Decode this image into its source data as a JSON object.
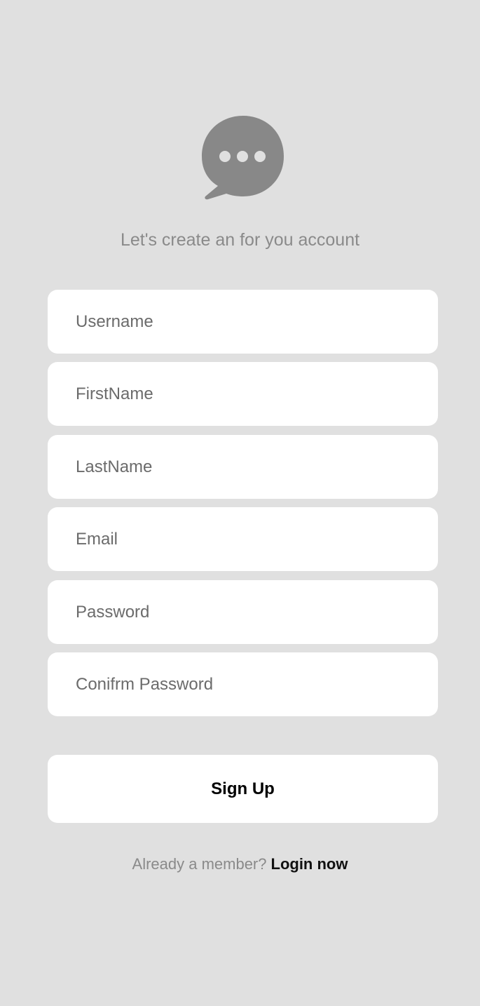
{
  "app": {
    "logo_icon": "chat-bubble-icon",
    "subtitle": "Let's create an for you account"
  },
  "form": {
    "fields": [
      {
        "name": "username",
        "placeholder": "Username",
        "value": ""
      },
      {
        "name": "firstname",
        "placeholder": "FirstName",
        "value": ""
      },
      {
        "name": "lastname",
        "placeholder": "LastName",
        "value": ""
      },
      {
        "name": "email",
        "placeholder": "Email",
        "value": ""
      },
      {
        "name": "password",
        "placeholder": "Password",
        "value": ""
      },
      {
        "name": "confirm_password",
        "placeholder": "Conifrm Password",
        "value": ""
      }
    ],
    "submit_label": "Sign Up"
  },
  "footer": {
    "prompt": "Already a member?",
    "link_label": "Login now"
  },
  "colors": {
    "background": "#e0e0e0",
    "surface": "#ffffff",
    "icon": "#888888",
    "muted_text": "#8a8a8a"
  }
}
